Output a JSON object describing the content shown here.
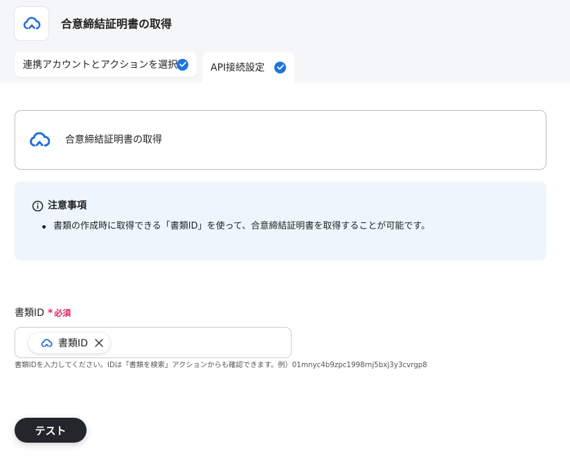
{
  "header": {
    "title": "合意締結証明書の取得",
    "app_icon": "cloud-upload-icon"
  },
  "tabs": [
    {
      "label": "連携アカウントとアクションを選択",
      "completed": true
    },
    {
      "label": "API接続設定",
      "completed": true,
      "active": true
    }
  ],
  "action": {
    "label": "合意締結証明書の取得",
    "icon": "cloud-upload-icon"
  },
  "notice": {
    "title": "注意事項",
    "items": [
      "書類の作成時に取得できる「書類ID」を使って、合意締結証明書を取得することが可能です。"
    ]
  },
  "field": {
    "label": "書類ID",
    "required_mark": "*",
    "required_text": "必須",
    "chip_label": "書類ID",
    "help": "書類IDを入力してください。IDは「書類を検索」アクションからも確認できます。例）01mnyc4b9zpc1998rnj5bxj3y3cvrgp8"
  },
  "buttons": {
    "test": "テスト"
  },
  "colors": {
    "accent": "#1f75e0",
    "required": "#e0245e",
    "notice_bg": "#eef5fc",
    "button_dark": "#23262b"
  }
}
